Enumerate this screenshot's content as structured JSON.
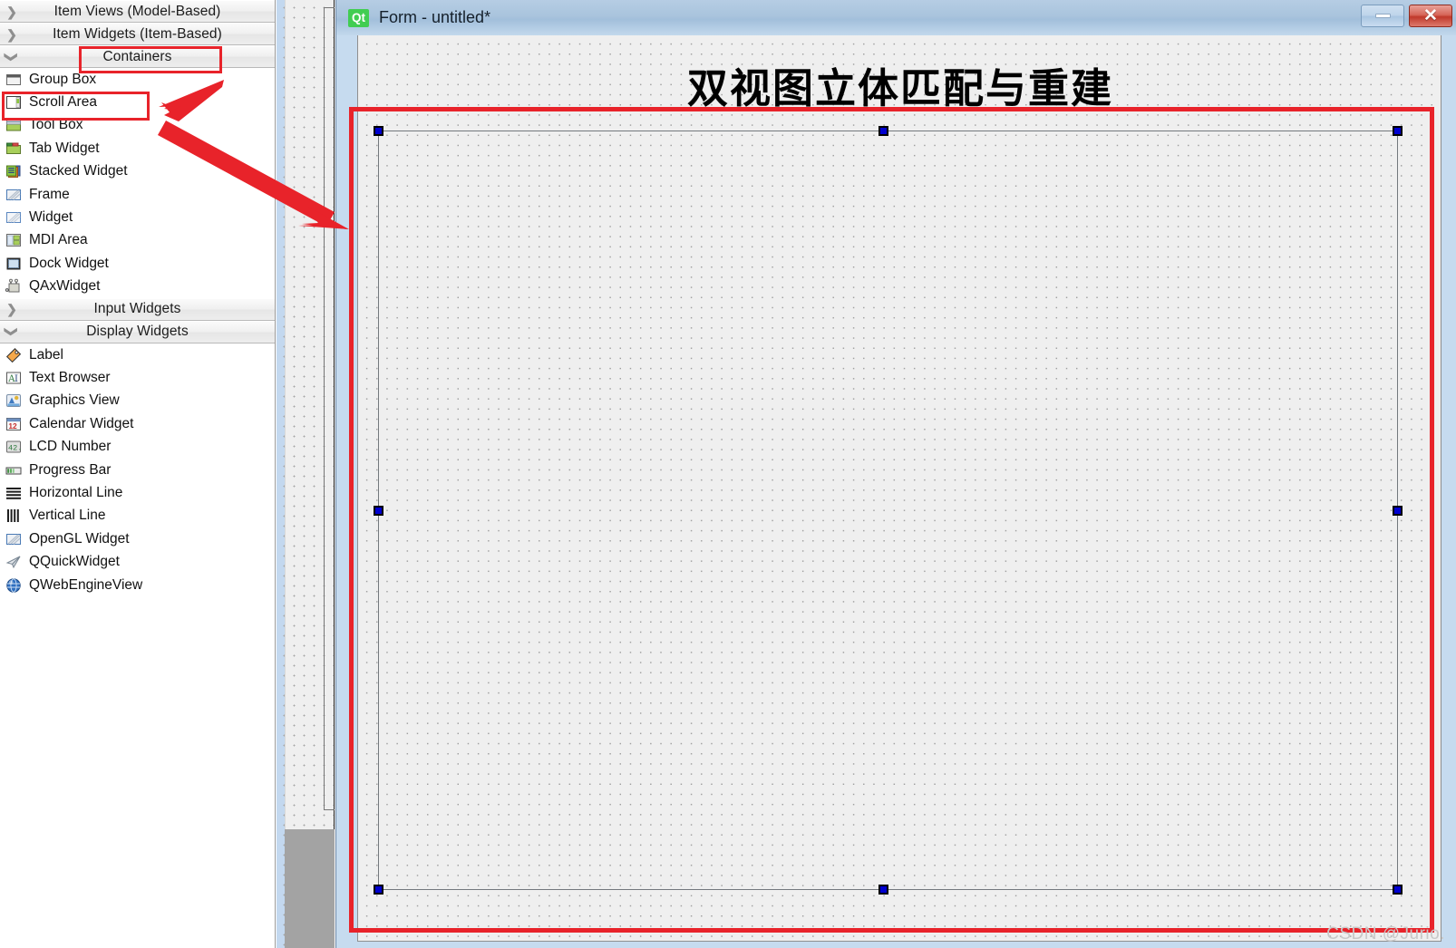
{
  "widget_box": {
    "categories": [
      {
        "label": "Item Views (Model-Based)",
        "chevron": "chevron-right-icon",
        "expanded": false,
        "items": []
      },
      {
        "label": "Item Widgets (Item-Based)",
        "chevron": "chevron-right-icon",
        "expanded": false,
        "items": []
      },
      {
        "label": "Containers",
        "chevron": "chevron-down-icon",
        "expanded": true,
        "items": [
          {
            "label": "Group Box",
            "icon": "group-box-icon"
          },
          {
            "label": "Scroll Area",
            "icon": "scroll-area-icon"
          },
          {
            "label": "Tool Box",
            "icon": "tool-box-icon"
          },
          {
            "label": "Tab Widget",
            "icon": "tab-widget-icon"
          },
          {
            "label": "Stacked Widget",
            "icon": "stacked-widget-icon"
          },
          {
            "label": "Frame",
            "icon": "frame-icon"
          },
          {
            "label": "Widget",
            "icon": "widget-icon"
          },
          {
            "label": "MDI Area",
            "icon": "mdi-area-icon"
          },
          {
            "label": "Dock Widget",
            "icon": "dock-widget-icon"
          },
          {
            "label": "QAxWidget",
            "icon": "qax-widget-icon"
          }
        ]
      },
      {
        "label": "Input Widgets",
        "chevron": "chevron-right-icon",
        "expanded": false,
        "items": []
      },
      {
        "label": "Display Widgets",
        "chevron": "chevron-down-icon",
        "expanded": true,
        "items": [
          {
            "label": "Label",
            "icon": "label-icon"
          },
          {
            "label": "Text Browser",
            "icon": "text-browser-icon"
          },
          {
            "label": "Graphics View",
            "icon": "graphics-view-icon"
          },
          {
            "label": "Calendar Widget",
            "icon": "calendar-widget-icon"
          },
          {
            "label": "LCD Number",
            "icon": "lcd-number-icon"
          },
          {
            "label": "Progress Bar",
            "icon": "progress-bar-icon"
          },
          {
            "label": "Horizontal Line",
            "icon": "horizontal-line-icon"
          },
          {
            "label": "Vertical Line",
            "icon": "vertical-line-icon"
          },
          {
            "label": "OpenGL Widget",
            "icon": "opengl-widget-icon"
          },
          {
            "label": "QQuickWidget",
            "icon": "qquick-widget-icon"
          },
          {
            "label": "QWebEngineView",
            "icon": "qwebengineview-icon"
          }
        ]
      }
    ]
  },
  "form_window": {
    "logo_text": "Qt",
    "title": "Form - untitled*",
    "buttons": {
      "minimize": "–",
      "close": "✕"
    },
    "canvas": {
      "heading": "双视图立体匹配与重建",
      "selected_widget": "scroll-area"
    }
  },
  "annotations": {
    "accent_color": "#e8232a",
    "highlight_boxes": [
      "Containers",
      "Scroll Area",
      "form-scroll-area"
    ],
    "arrows": 2
  },
  "watermark": "CSDN @Jurio."
}
